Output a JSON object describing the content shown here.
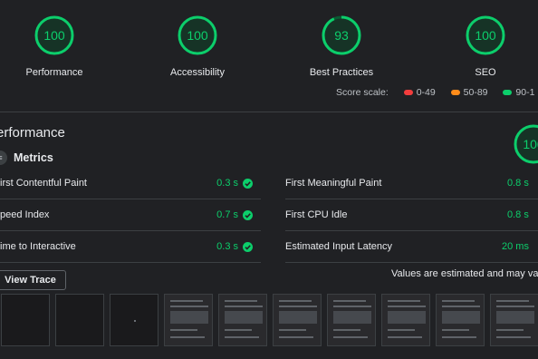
{
  "scores": [
    {
      "label": "Performance",
      "value": "100"
    },
    {
      "label": "Accessibility",
      "value": "100"
    },
    {
      "label": "Best Practices",
      "value": "93"
    },
    {
      "label": "SEO",
      "value": "100"
    }
  ],
  "score_scale": {
    "label": "Score scale:",
    "ranges": [
      {
        "label": "0-49",
        "color": "#f33d3d"
      },
      {
        "label": "50-89",
        "color": "#ff8c1a"
      },
      {
        "label": "90-1",
        "color": "#0cce6b"
      }
    ]
  },
  "performance": {
    "title": "erformance",
    "score": "100",
    "metrics_title": "Metrics",
    "metrics": [
      {
        "name": "irst Contentful Paint",
        "value": "0.3 s"
      },
      {
        "name": "First Meaningful Paint",
        "value": "0.8 s"
      },
      {
        "name": "peed Index",
        "value": "0.7 s"
      },
      {
        "name": "First CPU Idle",
        "value": "0.8 s"
      },
      {
        "name": "ime to Interactive",
        "value": "0.3 s"
      },
      {
        "name": "Estimated Input Latency",
        "value": "20 ms"
      }
    ],
    "view_trace_label": "View Trace",
    "estimate_note": "Values are estimated and may var"
  },
  "colors": {
    "pass": "#0cce6b",
    "background": "#202124",
    "divider": "#3c4043"
  }
}
